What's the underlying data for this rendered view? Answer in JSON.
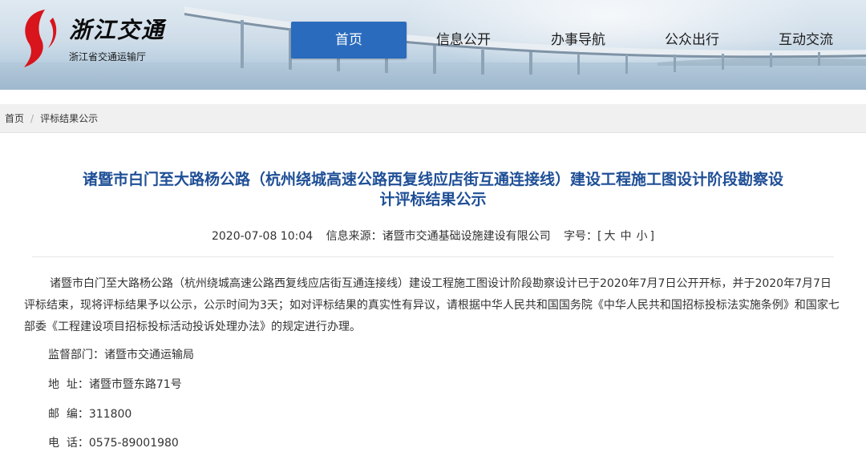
{
  "header": {
    "logo_title": "浙江交通",
    "logo_subtitle": "浙江省交通运输厅",
    "colors": {
      "nav_active_bg": "#2a6bbd",
      "logo_red": "#d8141c",
      "title_blue": "#1f4f96"
    }
  },
  "nav": {
    "items": [
      {
        "label": "首页",
        "active": true
      },
      {
        "label": "信息公开",
        "active": false
      },
      {
        "label": "办事导航",
        "active": false
      },
      {
        "label": "公众出行",
        "active": false
      },
      {
        "label": "互动交流",
        "active": false
      }
    ]
  },
  "breadcrumb": {
    "home": "首页",
    "separator": "/",
    "current": "评标结果公示"
  },
  "article": {
    "title_line1": "诸暨市白门至大路杨公路（杭州绕城高速公路西复线应店街互通连接线）建设工程施工图设计阶段勘察设",
    "title_line2": "计评标结果公示",
    "date": "2020-07-08 10:04",
    "source": "信息来源：诸暨市交通基础设施建设有限公司",
    "font_size_label": "字号：[",
    "font_size_large": "大",
    "font_size_medium": "中",
    "font_size_small": "小",
    "font_size_close": "]",
    "body": "诸暨市白门至大路杨公路（杭州绕城高速公路西复线应店街互通连接线）建设工程施工图设计阶段勘察设计已于2020年7月7日公开开标，并于2020年7月7日评标结束，现将评标结果予以公示，公示时间为3天；如对评标结果的真实性有异议，请根据中华人民共和国国务院《中华人民共和国招标投标法实施条例》和国家七部委《工程建设项目招标投标活动投诉处理办法》的规定进行办理。",
    "supervisor": "监督部门：诸暨市交通运输局",
    "address": "地  址：诸暨市暨东路71号",
    "postcode": "邮  编：311800",
    "phone": "电  话：0575-89001980"
  }
}
